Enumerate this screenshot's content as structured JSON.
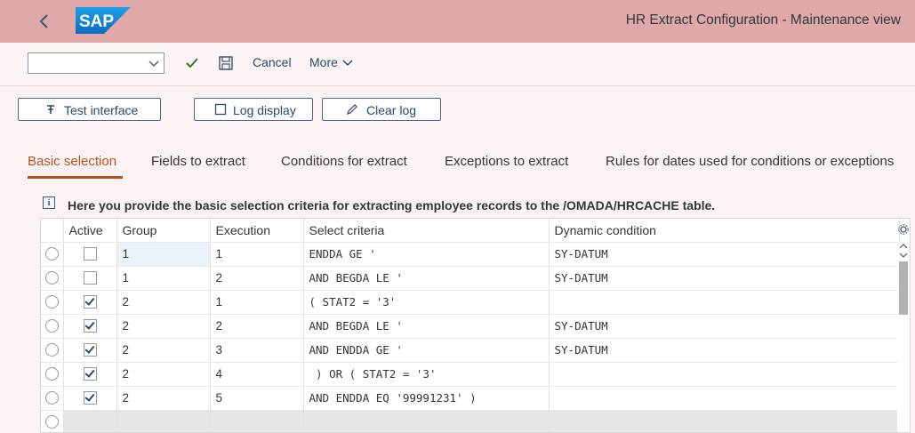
{
  "shell": {
    "title": "HR Extract Configuration - Maintenance view",
    "logo_text": "SAP"
  },
  "toolbar": {
    "dropdown_value": "",
    "cancel_label": "Cancel",
    "more_label": "More"
  },
  "actions": {
    "test_interface": "Test interface",
    "log_display": "Log display",
    "clear_log": "Clear log"
  },
  "tabs": [
    {
      "label": "Basic selection",
      "selected": true
    },
    {
      "label": "Fields to extract",
      "selected": false
    },
    {
      "label": "Conditions for extract",
      "selected": false
    },
    {
      "label": "Exceptions to extract",
      "selected": false
    },
    {
      "label": "Rules for dates used for conditions or exceptions",
      "selected": false
    }
  ],
  "info": {
    "icon_text": "i",
    "text": "Here you provide the basic selection criteria for extracting employee records to the /OMADA/HRCACHE table."
  },
  "table": {
    "headers": {
      "active": "Active",
      "group": "Group",
      "execution": "Execution",
      "select_criteria": "Select criteria",
      "dynamic_condition": "Dynamic condition"
    },
    "rows": [
      {
        "active": false,
        "group": "1",
        "execution": "1",
        "select_criteria": "ENDDA GE '",
        "dynamic_condition": "SY-DATUM"
      },
      {
        "active": false,
        "group": "1",
        "execution": "2",
        "select_criteria": "AND BEGDA LE '",
        "dynamic_condition": "SY-DATUM"
      },
      {
        "active": true,
        "group": "2",
        "execution": "1",
        "select_criteria": "( STAT2 = '3'",
        "dynamic_condition": ""
      },
      {
        "active": true,
        "group": "2",
        "execution": "2",
        "select_criteria": "AND BEGDA LE '",
        "dynamic_condition": "SY-DATUM"
      },
      {
        "active": true,
        "group": "2",
        "execution": "3",
        "select_criteria": "AND ENDDA GE '",
        "dynamic_condition": "SY-DATUM"
      },
      {
        "active": true,
        "group": "2",
        "execution": "4",
        "select_criteria": " ) OR ( STAT2 = '3'",
        "dynamic_condition": ""
      },
      {
        "active": true,
        "group": "2",
        "execution": "5",
        "select_criteria": "AND ENDDA EQ '99991231' )",
        "dynamic_condition": ""
      }
    ]
  },
  "colors": {
    "shell_bg": "#dfa9a9",
    "accent": "#b3541e",
    "page_bg": "#fbf3f3",
    "check_green": "#2b7d2b"
  }
}
